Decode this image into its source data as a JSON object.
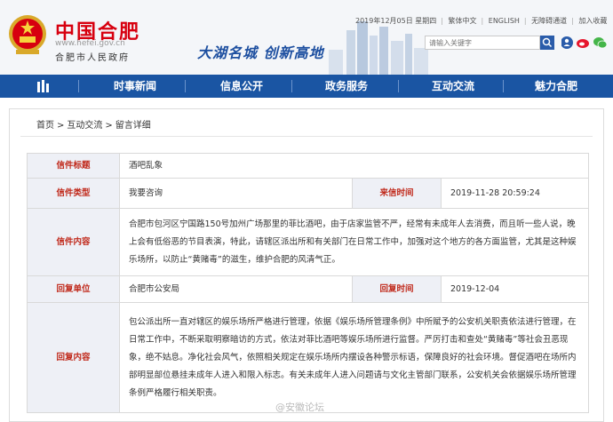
{
  "header": {
    "title": "中国合肥",
    "url": "www.hefei.gov.cn",
    "subtitle": "合肥市人民政府",
    "slogan": "大湖名城  创新高地",
    "date": "2019年12月05日 星期四",
    "links": [
      "繁体中文",
      "ENGLISH",
      "无障碍通道",
      "加入收藏"
    ],
    "search_placeholder": "请输入关键字"
  },
  "nav": {
    "items": [
      "时事新闻",
      "信息公开",
      "政务服务",
      "互动交流",
      "魅力合肥"
    ]
  },
  "breadcrumb": [
    "首页",
    "互动交流",
    "留言详细"
  ],
  "detail": {
    "title_label": "信件标题",
    "title_value": "酒吧乱象",
    "type_label": "信件类型",
    "type_value": "我要咨询",
    "time_label": "来信时间",
    "time_value": "2019-11-28 20:59:24",
    "content_label": "信件内容",
    "content_value": "合肥市包河区宁国路150号加州广场那里的菲比酒吧，由于店家监管不严，经常有未成年人去消费，而且听一些人说，晚上会有低俗恶的节目表演，特此，请辖区派出所和有关部门在日常工作中，加强对这个地方的各方面监管，尤其是这种娱乐场所，以防止“黄赌毒”的滋生，维护合肥的风清气正。",
    "unit_label": "回复单位",
    "unit_value": "合肥市公安局",
    "reply_time_label": "回复时间",
    "reply_time_value": "2019-12-04",
    "reply_label": "回复内容",
    "reply_value": "包公派出所一直对辖区的娱乐场所严格进行管理，依据《娱乐场所管理条例》中所赋予的公安机关职责依法进行管理，在日常工作中，不断采取明察暗访的方式，依法对菲比酒吧等娱乐场所进行监督。严厉打击和查处“黄赌毒”等社会丑恶现象，绝不姑息。净化社会风气，依照相关规定在娱乐场所内摆设各种警示标语，保障良好的社会环境。督促酒吧在场所内部明显部位悬挂未成年人进入和限入标志。有关未成年人进入问题请与文化主管部门联系，公安机关会依据娱乐场所管理条例严格履行相关职责。"
  },
  "watermark": "@安徽论坛",
  "colors": {
    "brand_red": "#d7000f",
    "nav_blue": "#1a55a3",
    "label_red": "#c0291b"
  }
}
